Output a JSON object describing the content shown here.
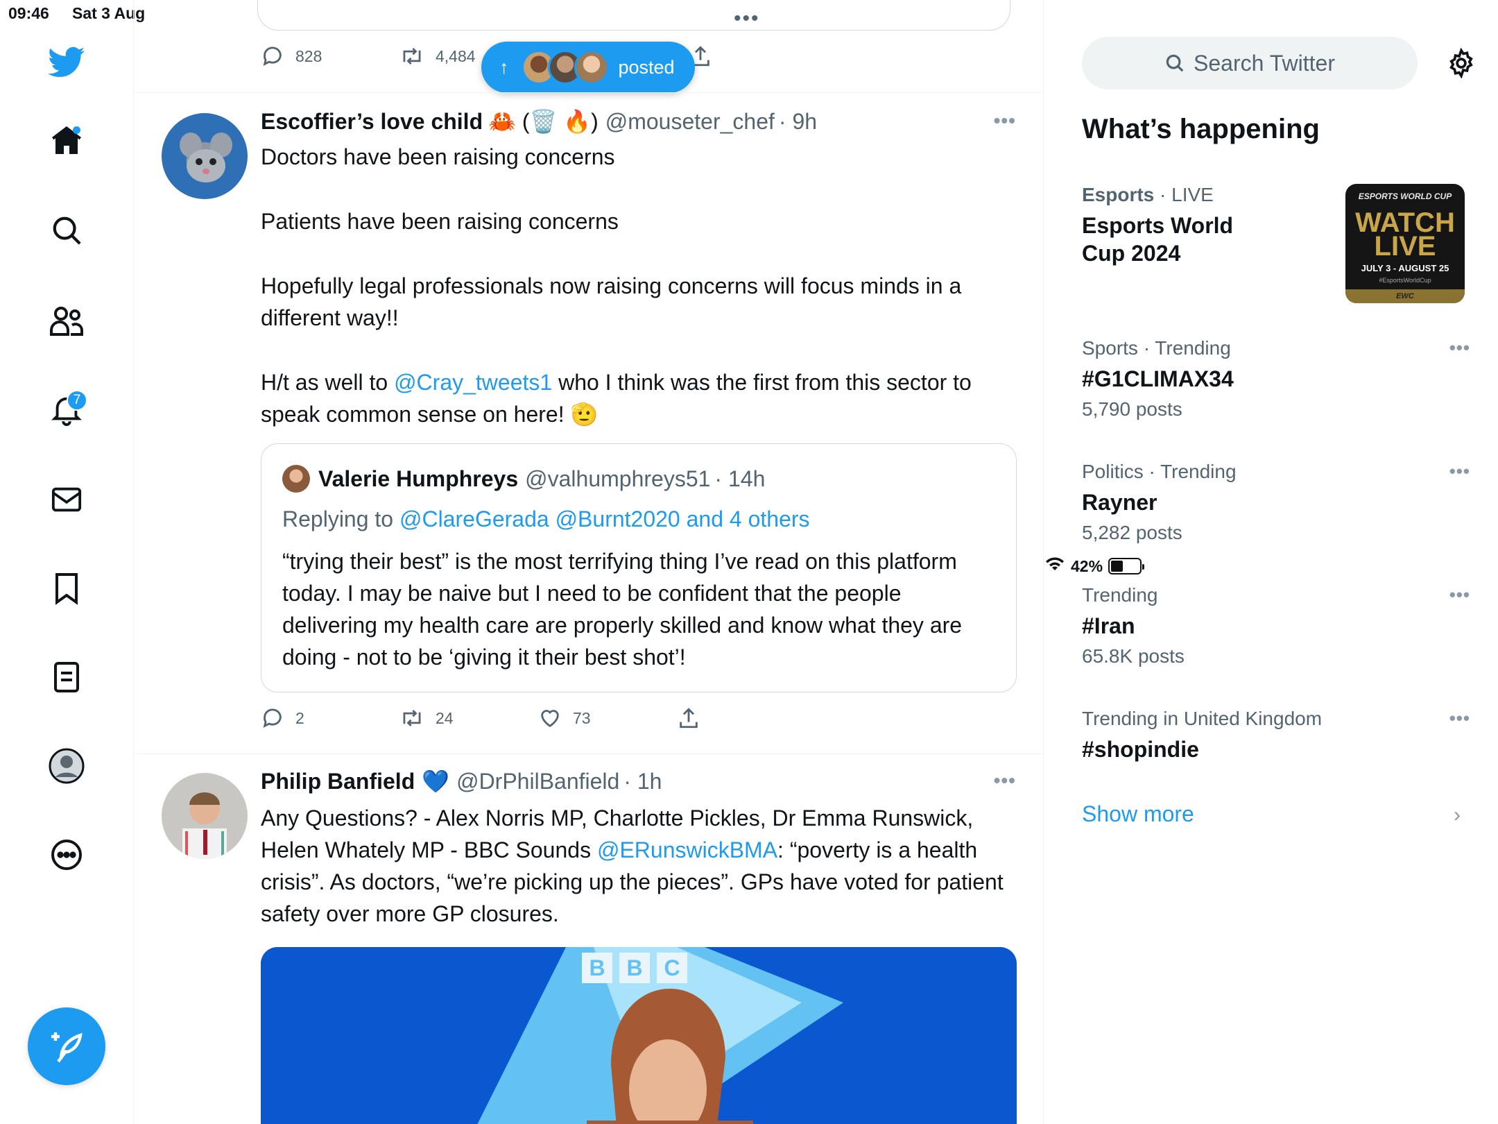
{
  "status": {
    "time": "09:46",
    "date": "Sat 3 Aug",
    "battery": "42%",
    "battery_level": 0.42
  },
  "nav": {
    "notifications_badge": "7"
  },
  "top_tweet": {
    "replies": "828",
    "retweets": "4,484"
  },
  "new_posts_pill": {
    "label": "posted"
  },
  "tweet1": {
    "name": "Escoffier’s love child",
    "name_emojis": "🦀 (🗑️ 🔥)",
    "handle": "@mouseter_chef",
    "time": "· 9h",
    "line1": "Doctors have been raising concerns",
    "line2": "Patients have been raising concerns",
    "line3": "Hopefully legal professionals now raising concerns will focus minds in a different way!!",
    "line4_pre": "H/t as well to ",
    "line4_mention": "@Cray_tweets1",
    "line4_post": " who I think was the first from this sector to speak common sense on here! 🫡",
    "quote": {
      "name": "Valerie Humphreys",
      "handle": "@valhumphreys51",
      "time": "· 14h",
      "replying_prefix": "Replying to ",
      "replying_to": "@ClareGerada @Burnt2020 and 4 others",
      "text": "“trying their best” is the most terrifying thing I’ve read on this platform today. I may be naive but I need to be confident that the people delivering my health care are properly skilled and know what they are doing - not to be ‘giving it their best shot’!"
    },
    "replies": "2",
    "retweets": "24",
    "likes": "73"
  },
  "tweet2": {
    "name": "Philip Banfield",
    "name_emoji": "💙",
    "handle": "@DrPhilBanfield",
    "time": "· 1h",
    "text_pre": "Any Questions? - Alex Norris MP, Charlotte Pickles, Dr Emma Runswick, Helen Whately MP - BBC Sounds ",
    "mention": "@ERunswickBMA",
    "text_post": ": “poverty is a health crisis”. As doctors, “we’re picking up the pieces”. GPs have voted for patient safety over more GP closures.",
    "media_logo": [
      "B",
      "B",
      "C"
    ]
  },
  "sidebar": {
    "search_placeholder": "Search Twitter",
    "heading": "What’s happening",
    "trends": [
      {
        "category": "Esports",
        "sub": "· LIVE",
        "title": "Esports World Cup 2024",
        "posts": ""
      },
      {
        "category": "Sports · Trending",
        "sub": "",
        "title": "#G1CLIMAX34",
        "posts": "5,790 posts"
      },
      {
        "category": "Politics · Trending",
        "sub": "",
        "title": "Rayner",
        "posts": "5,282 posts"
      },
      {
        "category": "Trending",
        "sub": "",
        "title": "#Iran",
        "posts": "65.8K posts"
      },
      {
        "category": "Trending in United Kingdom",
        "sub": "",
        "title": "#shopindie",
        "posts": ""
      }
    ],
    "esports_image": {
      "top": "ESPORTS WORLD CUP",
      "main1": "WATCH",
      "main2": "LIVE",
      "dates": "JULY 3 - AUGUST 25",
      "tag": "#EsportsWorldCup",
      "strip": "EWC"
    },
    "show_more": "Show more"
  }
}
